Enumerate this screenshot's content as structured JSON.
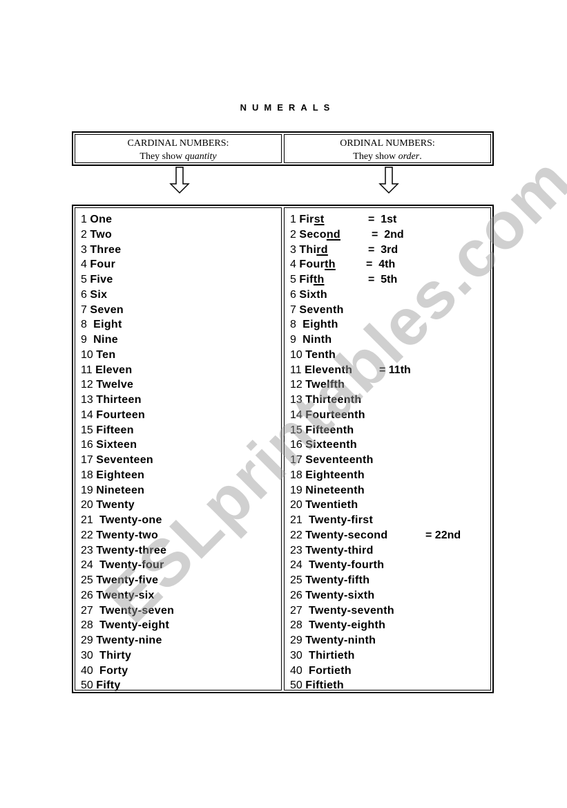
{
  "title": "NUMERALS",
  "header": {
    "cardinal": {
      "heading": "CARDINAL NUMBERS:",
      "desc_prefix": "They show ",
      "desc_emphasis": "quantity",
      "desc_suffix": ""
    },
    "ordinal": {
      "heading": "ORDINAL NUMBERS:",
      "desc_prefix": "They show ",
      "desc_emphasis": "order",
      "desc_suffix": "."
    }
  },
  "arrows": [
    "arrow-down-icon",
    "arrow-down-icon"
  ],
  "cardinal": [
    {
      "n": "1",
      "w": "One"
    },
    {
      "n": "2",
      "w": "Two"
    },
    {
      "n": "3",
      "w": "Three"
    },
    {
      "n": "4",
      "w": "Four"
    },
    {
      "n": "5",
      "w": "Five"
    },
    {
      "n": "6",
      "w": "Six"
    },
    {
      "n": "7",
      "w": "Seven"
    },
    {
      "n": "8",
      "w": " Eight"
    },
    {
      "n": "9",
      "w": " Nine"
    },
    {
      "n": "10",
      "w": "Ten"
    },
    {
      "n": "11",
      "w": "Eleven"
    },
    {
      "n": "12",
      "w": "Twelve"
    },
    {
      "n": "13",
      "w": "Thirteen"
    },
    {
      "n": "14",
      "w": "Fourteen"
    },
    {
      "n": "15",
      "w": "Fifteen"
    },
    {
      "n": "16",
      "w": "Sixteen"
    },
    {
      "n": "17",
      "w": "Seventeen"
    },
    {
      "n": "18",
      "w": "Eighteen"
    },
    {
      "n": "19",
      "w": "Nineteen"
    },
    {
      "n": "20",
      "w": "Twenty"
    },
    {
      "n": "21",
      "w": " Twenty-one"
    },
    {
      "n": "22",
      "w": "Twenty-two"
    },
    {
      "n": "23",
      "w": "Twenty-three"
    },
    {
      "n": "24",
      "w": " Twenty-four"
    },
    {
      "n": "25",
      "w": "Twenty-five"
    },
    {
      "n": "26",
      "w": "Twenty-six"
    },
    {
      "n": "27",
      "w": " Twenty-seven"
    },
    {
      "n": "28",
      "w": " Twenty-eight"
    },
    {
      "n": "29",
      "w": "Twenty-nine"
    },
    {
      "n": "30",
      "w": " Thirty"
    },
    {
      "n": "40",
      "w": " Forty"
    },
    {
      "n": "50",
      "w": "Fifty"
    }
  ],
  "ordinal": [
    {
      "n": "1",
      "stem": "Fir",
      "suffix": "st",
      "abbr": "=  1st"
    },
    {
      "n": "2",
      "stem": "Seco",
      "suffix": "nd",
      "abbr": "=  2nd"
    },
    {
      "n": "3",
      "stem": "Thi",
      "suffix": "rd",
      "abbr": "=  3rd"
    },
    {
      "n": "4",
      "stem": "Four",
      "suffix": "th",
      "abbr": "=  4th"
    },
    {
      "n": "5",
      "stem": "Fif",
      "suffix": "th",
      "abbr": "=  5th"
    },
    {
      "n": "6",
      "stem": "Sixth",
      "suffix": "",
      "abbr": ""
    },
    {
      "n": "7",
      "stem": "Seventh",
      "suffix": "",
      "abbr": ""
    },
    {
      "n": "8",
      "stem": " Eighth",
      "suffix": "",
      "abbr": ""
    },
    {
      "n": "9",
      "stem": " Ninth",
      "suffix": "",
      "abbr": ""
    },
    {
      "n": "10",
      "stem": "Tenth",
      "suffix": "",
      "abbr": ""
    },
    {
      "n": "11",
      "stem": "Eleventh",
      "suffix": "",
      "abbr": "= 11th"
    },
    {
      "n": "12",
      "stem": "Twelfth",
      "suffix": "",
      "abbr": ""
    },
    {
      "n": "13",
      "stem": "Thirteenth",
      "suffix": "",
      "abbr": ""
    },
    {
      "n": "14",
      "stem": "Fourteenth",
      "suffix": "",
      "abbr": ""
    },
    {
      "n": "15",
      "stem": "Fifteenth",
      "suffix": "",
      "abbr": ""
    },
    {
      "n": "16",
      "stem": "Sixteenth",
      "suffix": "",
      "abbr": ""
    },
    {
      "n": "17",
      "stem": "Seventeenth",
      "suffix": "",
      "abbr": ""
    },
    {
      "n": "18",
      "stem": "Eighteenth",
      "suffix": "",
      "abbr": ""
    },
    {
      "n": "19",
      "stem": "Nineteenth",
      "suffix": "",
      "abbr": ""
    },
    {
      "n": "20",
      "stem": "Twentieth",
      "suffix": "",
      "abbr": ""
    },
    {
      "n": "21",
      "stem": " Twenty-first",
      "suffix": "",
      "abbr": ""
    },
    {
      "n": "22",
      "stem": "Twenty-second",
      "suffix": "",
      "abbr": "= 22nd"
    },
    {
      "n": "23",
      "stem": "Twenty-third",
      "suffix": "",
      "abbr": ""
    },
    {
      "n": "24",
      "stem": " Twenty-fourth",
      "suffix": "",
      "abbr": ""
    },
    {
      "n": "25",
      "stem": "Twenty-fifth",
      "suffix": "",
      "abbr": ""
    },
    {
      "n": "26",
      "stem": "Twenty-sixth",
      "suffix": "",
      "abbr": ""
    },
    {
      "n": "27",
      "stem": " Twenty-seventh",
      "suffix": "",
      "abbr": ""
    },
    {
      "n": "28",
      "stem": " Twenty-eighth",
      "suffix": "",
      "abbr": ""
    },
    {
      "n": "29",
      "stem": "Twenty-ninth",
      "suffix": "",
      "abbr": ""
    },
    {
      "n": "30",
      "stem": " Thirtieth",
      "suffix": "",
      "abbr": ""
    },
    {
      "n": "40",
      "stem": " Fortieth",
      "suffix": "",
      "abbr": ""
    },
    {
      "n": "50",
      "stem": "Fiftieth",
      "suffix": "",
      "abbr": ""
    }
  ],
  "watermark": "ESLprintables.com"
}
